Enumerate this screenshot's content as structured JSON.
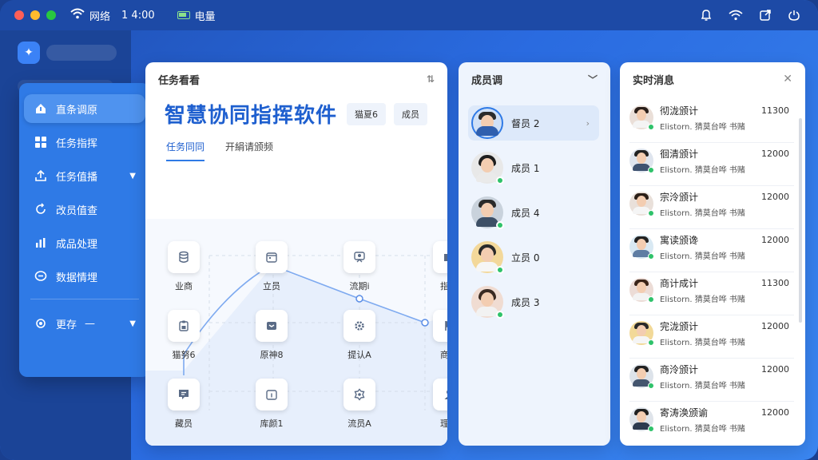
{
  "topbar": {
    "network_label": "网络",
    "time": "1 4:00",
    "battery_label": "电量"
  },
  "nav": {
    "items": [
      {
        "label": "直条调原",
        "icon": "home-icon"
      },
      {
        "label": "任务指挥",
        "icon": "grid-icon"
      },
      {
        "label": "任务值播",
        "icon": "upload-icon"
      },
      {
        "label": "改员值查",
        "icon": "refresh-icon"
      },
      {
        "label": "成品处理",
        "icon": "bar-chart-icon"
      },
      {
        "label": "数据情埋",
        "icon": "chat-icon"
      }
    ],
    "more_label": "更存",
    "more_dash": "—"
  },
  "task_panel": {
    "header": "任务看看",
    "app_title": "智慧协同指挥软件",
    "chip1": "猫夏6",
    "chip2": "成员",
    "tabs": [
      "任务同同",
      "开絹请颁频"
    ],
    "nodes": [
      {
        "label": "业商",
        "icon": "database-icon"
      },
      {
        "label": "立员",
        "icon": "calendar-icon"
      },
      {
        "label": "流期i",
        "icon": "chat-person-icon"
      },
      {
        "label": "指会",
        "icon": "folder-icon"
      },
      {
        "label": "猫努6",
        "icon": "clipboard-icon"
      },
      {
        "label": "原神8",
        "icon": "message-box-icon"
      },
      {
        "label": "提认A",
        "icon": "gear-icon"
      },
      {
        "label": "商会",
        "icon": "flag-icon"
      },
      {
        "label": "藏员",
        "icon": "note-icon"
      },
      {
        "label": "库颜1",
        "icon": "calendar-icon"
      },
      {
        "label": "流员A",
        "icon": "gear-icon"
      },
      {
        "label": "理会",
        "icon": "user-icon"
      }
    ]
  },
  "members_panel": {
    "header": "成员调",
    "members": [
      {
        "label": "督员 2",
        "selected": true
      },
      {
        "label": "成员 1",
        "selected": false
      },
      {
        "label": "成员 4",
        "selected": false
      },
      {
        "label": "立员 0",
        "selected": false
      },
      {
        "label": "成员 3",
        "selected": false
      }
    ]
  },
  "messages_panel": {
    "header": "实时消息",
    "messages": [
      {
        "name": "彻泷颁计",
        "preview": "Elistorn. 猜莫台哗 书赌",
        "time": "11300"
      },
      {
        "name": "徊清颁计",
        "preview": "Elistorn. 猜莫台哗 书赌",
        "time": "12000"
      },
      {
        "name": "宗泠颁计",
        "preview": "Elistorn. 猜莫台哗 书赌",
        "time": "12000"
      },
      {
        "name": "寓读颁谗",
        "preview": "Elistorn. 猜莫台哗 书赌",
        "time": "12000"
      },
      {
        "name": "商计成计",
        "preview": "Elistorn. 猜莫台哗 书赌",
        "time": "11300"
      },
      {
        "name": "完泷颁计",
        "preview": "Elistorn. 猜莫台哗 书赌",
        "time": "12000"
      },
      {
        "name": "商泠颁计",
        "preview": "Elistorn. 猜莫台哗 书赌",
        "time": "12000"
      },
      {
        "name": "寄涛涣颁谕",
        "preview": "Elistorn. 猜莫台哗 书赌",
        "time": "12000"
      }
    ]
  },
  "colors": {
    "accent": "#2f7ae6",
    "title_blue": "#1e5fcf",
    "online": "#2fc26a"
  }
}
